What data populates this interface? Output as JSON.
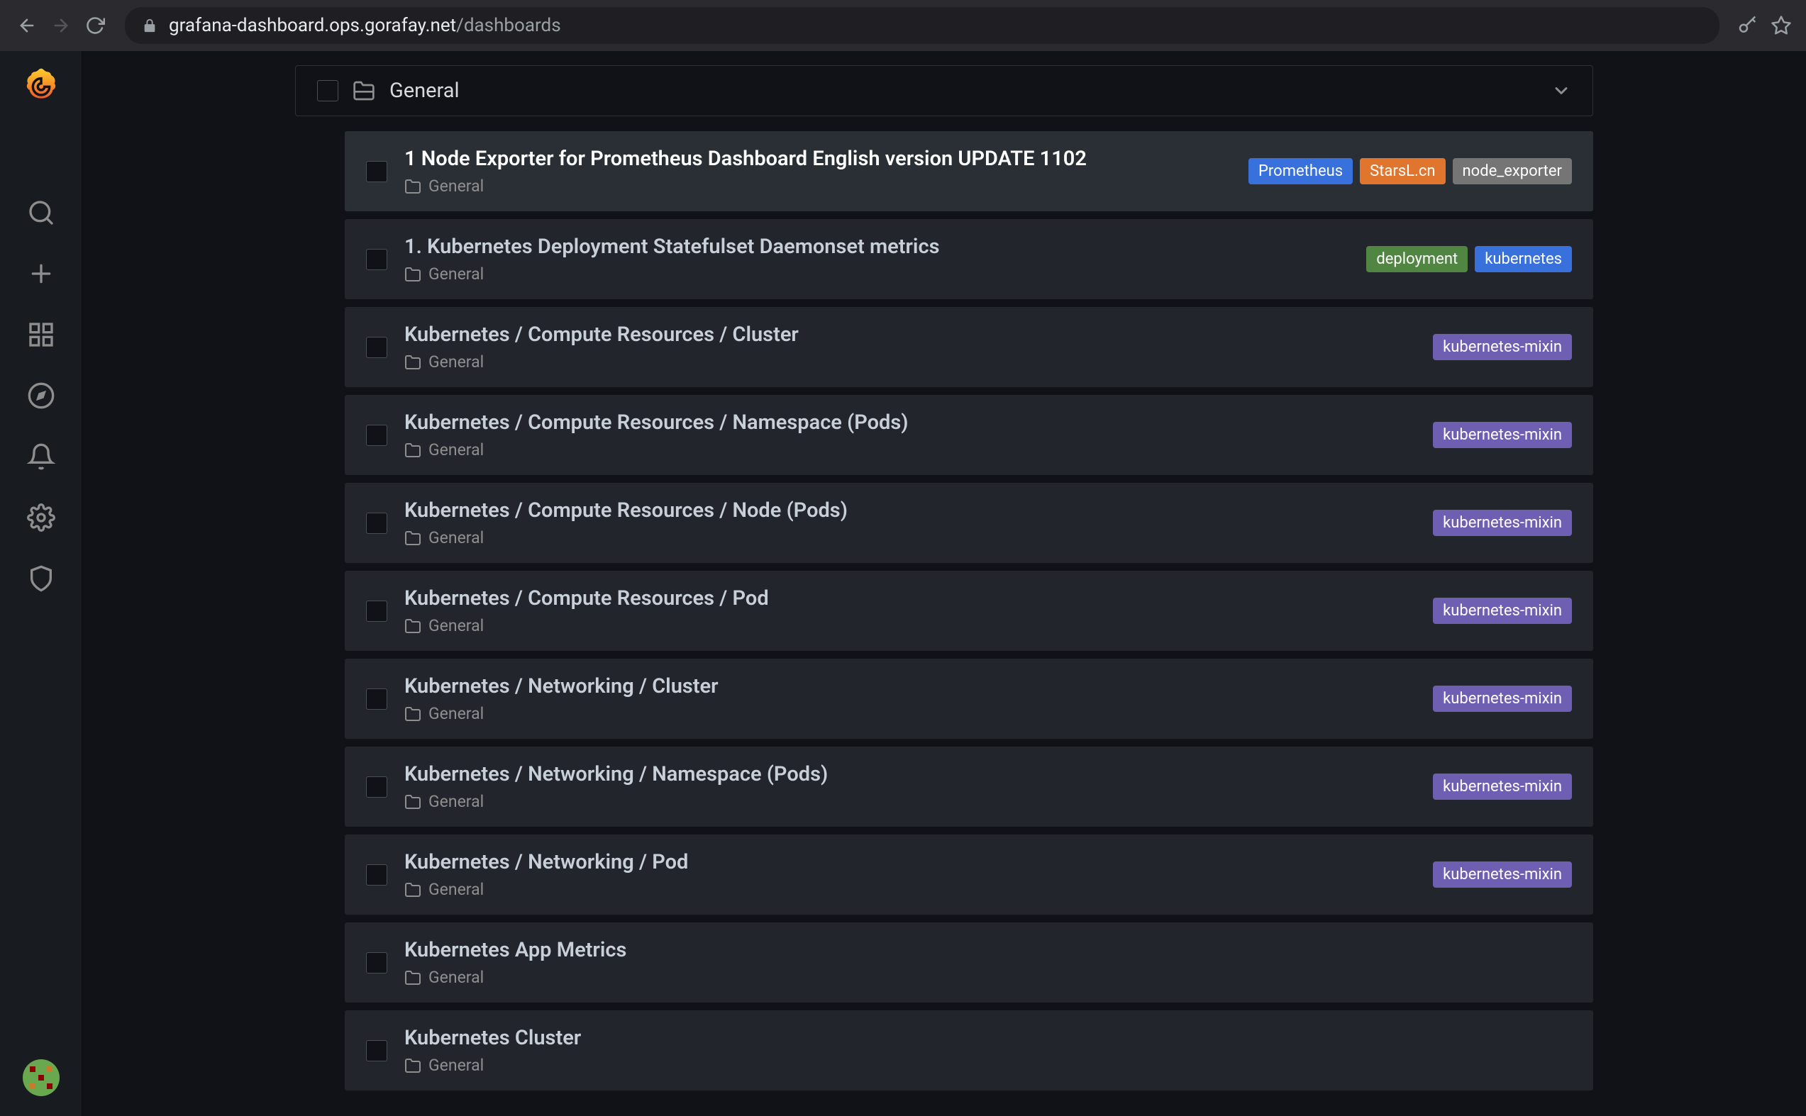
{
  "browser": {
    "url_host": "grafana-dashboard.ops.gorafay.net",
    "url_path": "/dashboards"
  },
  "folder": {
    "name": "General"
  },
  "tag_colors": {
    "Prometheus": "#3871dc",
    "StarsL.cn": "#e0752d",
    "node_exporter": "#757575",
    "deployment": "#508642",
    "kubernetes": "#3871dc",
    "kubernetes-mixin": "#6e5fb3"
  },
  "dashboards": [
    {
      "title": "1 Node Exporter for Prometheus Dashboard English version UPDATE 1102",
      "folder": "General",
      "tags": [
        "Prometheus",
        "StarsL.cn",
        "node_exporter"
      ],
      "highlight": true
    },
    {
      "title": "1. Kubernetes Deployment Statefulset Daemonset metrics",
      "folder": "General",
      "tags": [
        "deployment",
        "kubernetes"
      ],
      "highlight": false
    },
    {
      "title": "Kubernetes / Compute Resources / Cluster",
      "folder": "General",
      "tags": [
        "kubernetes-mixin"
      ],
      "highlight": false
    },
    {
      "title": "Kubernetes / Compute Resources / Namespace (Pods)",
      "folder": "General",
      "tags": [
        "kubernetes-mixin"
      ],
      "highlight": false
    },
    {
      "title": "Kubernetes / Compute Resources / Node (Pods)",
      "folder": "General",
      "tags": [
        "kubernetes-mixin"
      ],
      "highlight": false
    },
    {
      "title": "Kubernetes / Compute Resources / Pod",
      "folder": "General",
      "tags": [
        "kubernetes-mixin"
      ],
      "highlight": false
    },
    {
      "title": "Kubernetes / Networking / Cluster",
      "folder": "General",
      "tags": [
        "kubernetes-mixin"
      ],
      "highlight": false
    },
    {
      "title": "Kubernetes / Networking / Namespace (Pods)",
      "folder": "General",
      "tags": [
        "kubernetes-mixin"
      ],
      "highlight": false
    },
    {
      "title": "Kubernetes / Networking / Pod",
      "folder": "General",
      "tags": [
        "kubernetes-mixin"
      ],
      "highlight": false
    },
    {
      "title": "Kubernetes App Metrics",
      "folder": "General",
      "tags": [],
      "highlight": false
    },
    {
      "title": "Kubernetes Cluster",
      "folder": "General",
      "tags": [],
      "highlight": false
    }
  ]
}
